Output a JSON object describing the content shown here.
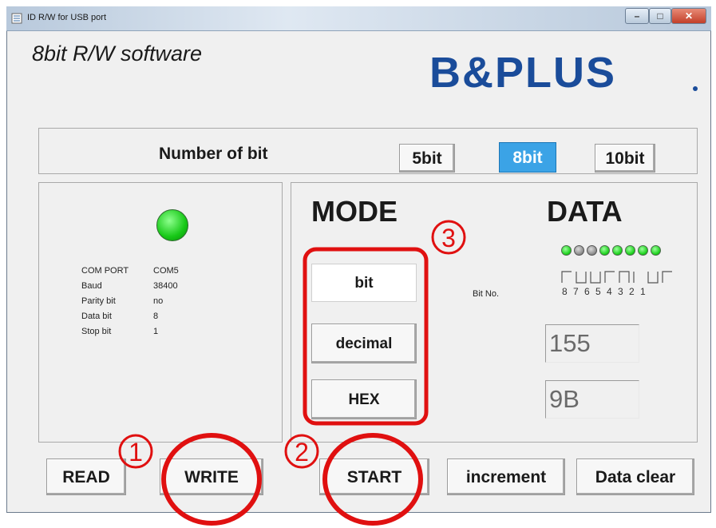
{
  "window": {
    "title": "ID R/W for USB port",
    "min_label": "–",
    "max_label": "□",
    "close_label": "✕"
  },
  "app": {
    "title": "8bit R/W software",
    "logo": "B&PLUS"
  },
  "bit_select": {
    "label": "Number of bit",
    "options": [
      "5bit",
      "8bit",
      "10bit"
    ],
    "selected": "8bit"
  },
  "status": {
    "led": "on",
    "settings": [
      {
        "key": "COM PORT",
        "value": "COM5"
      },
      {
        "key": "Baud",
        "value": "38400"
      },
      {
        "key": "Parity bit",
        "value": "no"
      },
      {
        "key": "Data bit",
        "value": "8"
      },
      {
        "key": "Stop bit",
        "value": "1"
      }
    ]
  },
  "mode": {
    "title": "MODE",
    "buttons": [
      "bit",
      "decimal",
      "HEX"
    ]
  },
  "data": {
    "title": "DATA",
    "bit_no_label": "Bit No.",
    "bit_numbers": "8 7 6 5 4 3 2 1",
    "leds": [
      "on",
      "off",
      "off",
      "on",
      "on",
      "on",
      "on",
      "on"
    ],
    "decimal_value": "155",
    "hex_value": "9B"
  },
  "actions": {
    "read": "READ",
    "write": "WRITE",
    "start": "START",
    "increment": "increment",
    "clear": "Data clear"
  },
  "annotations": {
    "one": "1",
    "two": "2",
    "three": "3"
  },
  "colors": {
    "selected_button": "#3ba3e6",
    "annotation": "#e01010",
    "led_on": "#1ed21e",
    "logo": "#1a4c9a"
  }
}
